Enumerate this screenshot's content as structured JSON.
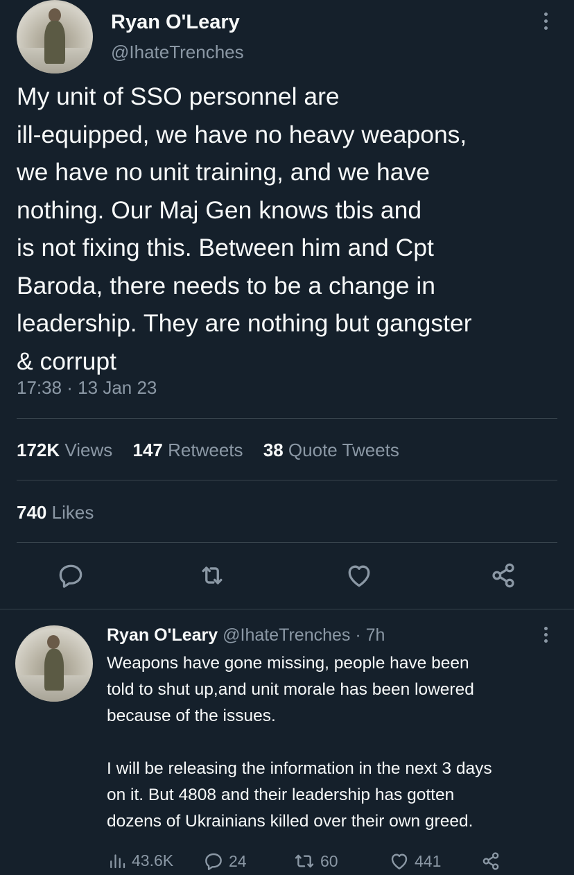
{
  "main_tweet": {
    "author_name": "Ryan O'Leary",
    "author_handle": "@IhateTrenches",
    "text": "My unit of SSO personnel are\nill-equipped, we have no heavy weapons,\nwe have no unit training, and we have\nnothing. Our Maj Gen knows tbis and\nis not fixing this. Between him and Cpt\nBaroda, there needs to be a change  in\nleadership.  They are nothing but gangster\n& corrupt",
    "timestamp": "17:38 · 13 Jan 23",
    "stats": {
      "views_count": "172K",
      "views_label": "Views",
      "retweets_count": "147",
      "retweets_label": "Retweets",
      "quotes_count": "38",
      "quotes_label": "Quote Tweets",
      "likes_count": "740",
      "likes_label": "Likes"
    },
    "actions": [
      "reply-icon",
      "retweet-icon",
      "like-icon",
      "share-icon"
    ]
  },
  "reply": {
    "author_name": "Ryan O'Leary",
    "author_handle": "@IhateTrenches",
    "separator": "·",
    "time": "7h",
    "text": "Weapons have gone missing, people have been\ntold to shut up,and unit morale has been lowered\nbecause of the issues.\n\nI will be releasing the information in the next 3 days\non it. But 4808 and their leadership has gotten\ndozens of Ukrainians killed over their own greed.",
    "actions": {
      "views": "43.6K",
      "replies": "24",
      "retweets": "60",
      "likes": "441"
    }
  },
  "colors": {
    "background": "#15202b",
    "text_primary": "#f7f9f9",
    "text_secondary": "#8b98a5",
    "divider": "#38444d"
  }
}
